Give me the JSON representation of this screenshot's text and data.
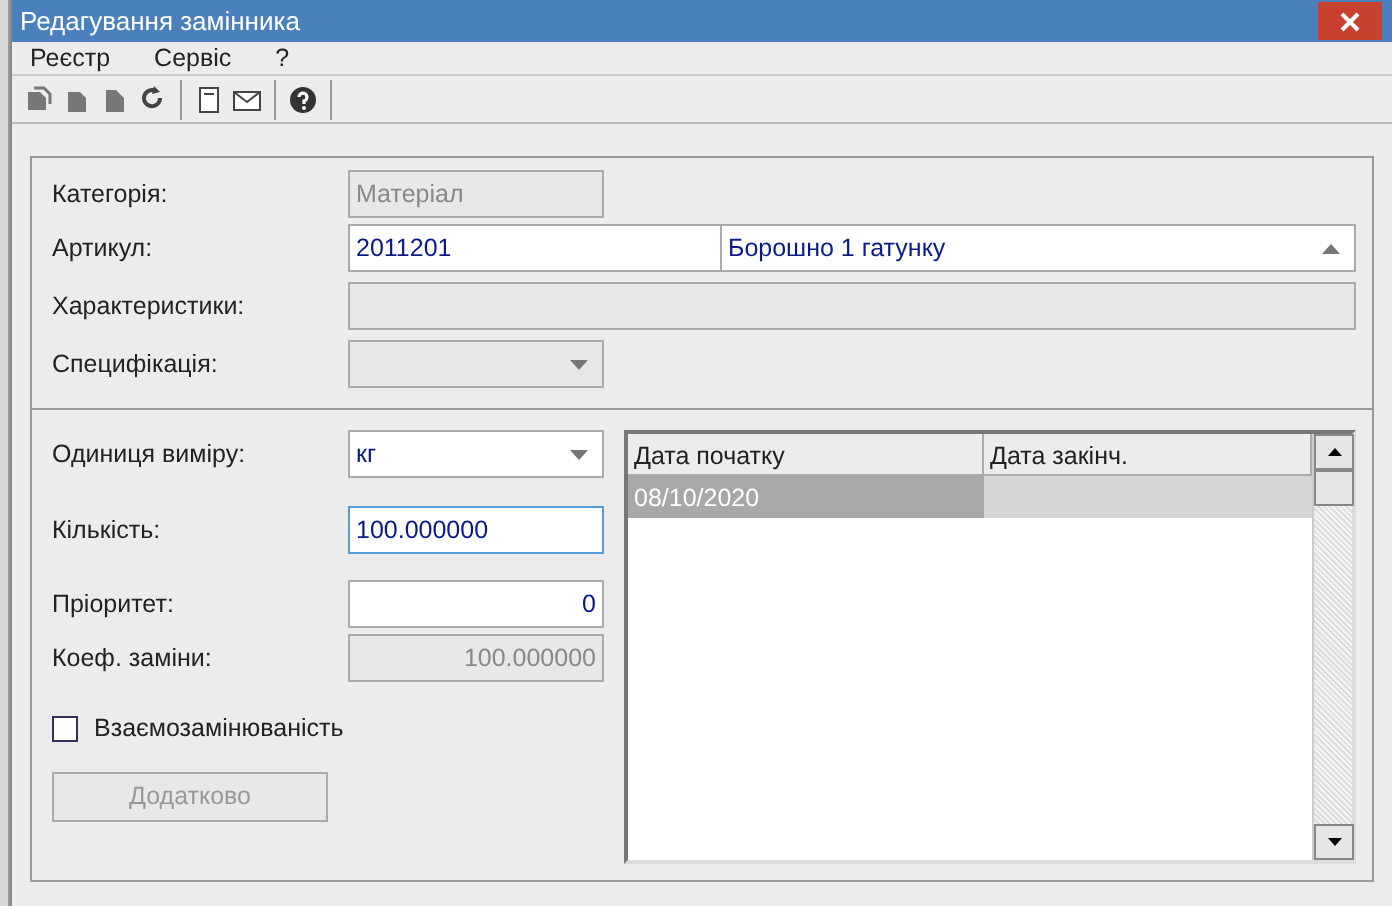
{
  "window": {
    "title": "Редагування замінника"
  },
  "menu": [
    "Реєстр",
    "Сервіс",
    "?"
  ],
  "fields": [
    {
      "label": "Категорія:",
      "kind": "text",
      "value": "Матеріал",
      "disabled": true
    },
    {
      "label": "Артикул:",
      "kind": "lookup",
      "value": "2011201",
      "description": "Борошно 1 гатунку",
      "disabled": false
    },
    {
      "label": "Характеристики:",
      "kind": "wide",
      "disabled": true
    },
    {
      "label": "Специфікація:",
      "kind": "select",
      "disabled": true
    }
  ],
  "details": [
    {
      "label": "Одиниця виміру:",
      "kind": "select",
      "value": "кг",
      "disabled": false,
      "focused": false
    },
    {
      "label": "Кількість:",
      "kind": "text",
      "value": "100.000000",
      "disabled": false,
      "focused": true
    },
    {
      "label": "Пріоритет:",
      "kind": "number",
      "value": "0",
      "disabled": false,
      "focused": false
    },
    {
      "label": "Коеф. заміни:",
      "kind": "number",
      "value": "100.000000",
      "disabled": true,
      "focused": false
    }
  ],
  "interchangeable": {
    "label": "Взаємозамінюваність",
    "checked": false
  },
  "more_button": {
    "label": "Додатково",
    "disabled": true
  },
  "table": {
    "columns": [
      "Дата початку",
      "Дата закінч."
    ],
    "rows": [
      {
        "cells": [
          "08/10/2020"
        ],
        "selected": true
      }
    ]
  }
}
